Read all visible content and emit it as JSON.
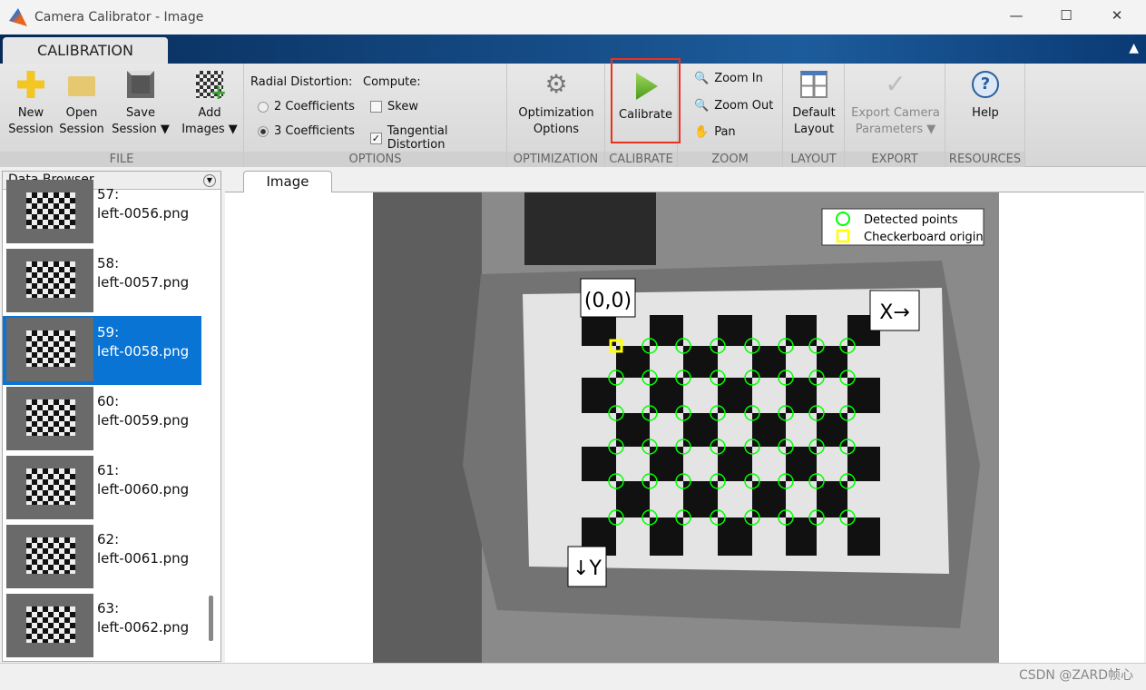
{
  "window": {
    "title": "Camera Calibrator - Image"
  },
  "ribbon": {
    "tab": "CALIBRATION",
    "file": {
      "label": "FILE",
      "new": [
        "New",
        "Session"
      ],
      "open": [
        "Open",
        "Session"
      ],
      "save": [
        "Save",
        "Session ▼"
      ],
      "add": [
        "Add",
        "Images ▼"
      ]
    },
    "options": {
      "label": "OPTIONS",
      "radial_label": "Radial Distortion:",
      "radial_options": [
        "2 Coefficients",
        "3 Coefficients"
      ],
      "radial_selected": "3 Coefficients",
      "compute_label": "Compute:",
      "skew": "Skew",
      "skew_checked": false,
      "tangential": "Tangential Distortion",
      "tangential_checked": true
    },
    "optimization": {
      "label": "OPTIMIZATION",
      "button": [
        "Optimization",
        "Options"
      ]
    },
    "calibrate": {
      "label": "CALIBRATE",
      "button": "Calibrate",
      "highlight_color": "#e8321e"
    },
    "zoom": {
      "label": "ZOOM",
      "zoom_in": "Zoom In",
      "zoom_out": "Zoom Out",
      "pan": "Pan"
    },
    "layout": {
      "label": "LAYOUT",
      "button": [
        "Default",
        "Layout"
      ]
    },
    "export": {
      "label": "EXPORT",
      "button": [
        "Export Camera",
        "Parameters ▼"
      ]
    },
    "resources": {
      "label": "RESOURCES",
      "button": "Help"
    }
  },
  "data_browser": {
    "title": "Data Browser",
    "selected_index": 2,
    "items": [
      {
        "num": "57:",
        "file": "left-0056.png"
      },
      {
        "num": "58:",
        "file": "left-0057.png"
      },
      {
        "num": "59:",
        "file": "left-0058.png"
      },
      {
        "num": "60:",
        "file": "left-0059.png"
      },
      {
        "num": "61:",
        "file": "left-0060.png"
      },
      {
        "num": "62:",
        "file": "left-0061.png"
      },
      {
        "num": "63:",
        "file": "left-0062.png"
      }
    ]
  },
  "image_tab": "Image",
  "image": {
    "legend": {
      "detected": "Detected points",
      "origin": "Checkerboard origin"
    },
    "origin_label": "(0,0)",
    "x_label": "X→",
    "y_label": "↓Y",
    "detected_color": "#00ff00",
    "origin_color": "#ffff00"
  },
  "watermark": "CSDN @ZARD帧心"
}
